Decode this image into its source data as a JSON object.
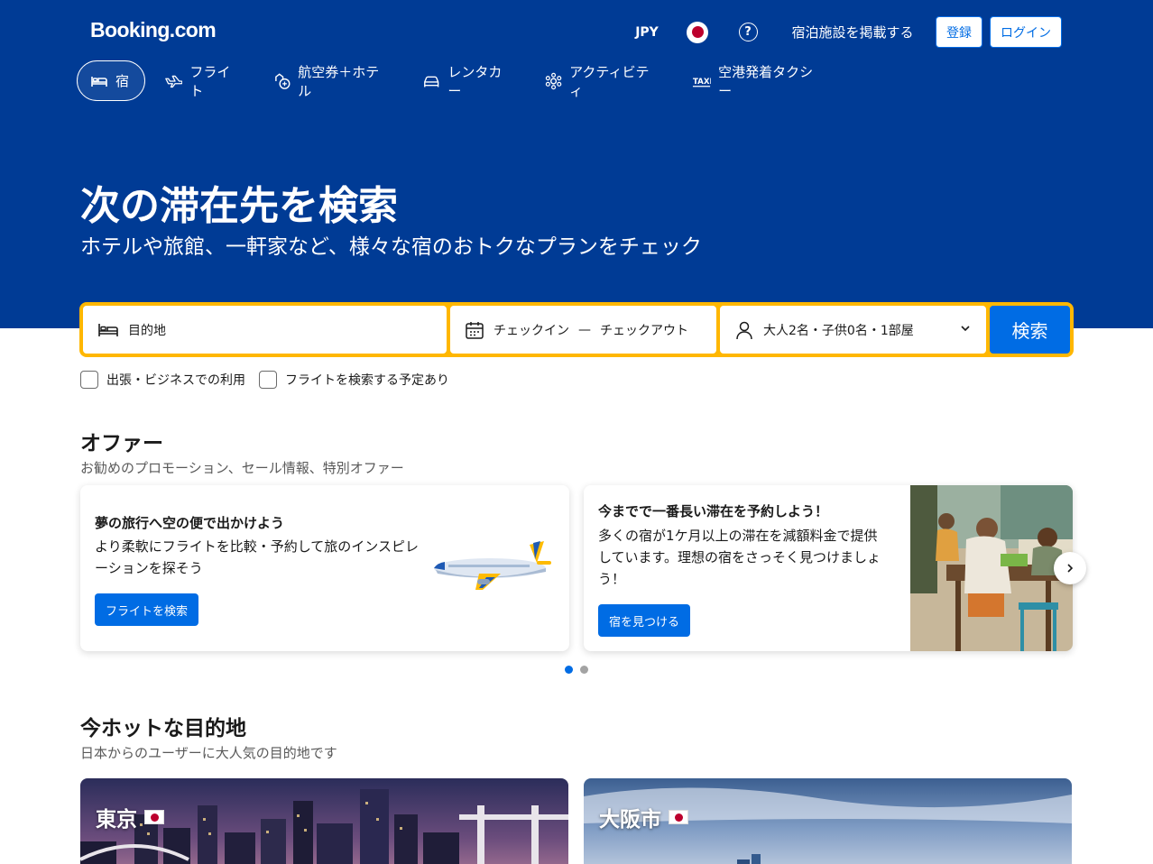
{
  "header": {
    "logo": "Booking.com",
    "currency": "JPY",
    "help_symbol": "?",
    "list_property": "宿泊施設を掲載する",
    "register": "登録",
    "login": "ログイン",
    "bg_color": "#003b95"
  },
  "nav": {
    "tabs": [
      {
        "label": "宿",
        "icon": "bed-icon",
        "active": true
      },
      {
        "label": "フライト",
        "icon": "plane-icon"
      },
      {
        "label": "航空券＋ホテル",
        "icon": "plane-hotel-icon"
      },
      {
        "label": "レンタカー",
        "icon": "car-icon"
      },
      {
        "label": "アクティビティ",
        "icon": "attractions-icon"
      },
      {
        "label": "空港発着タクシー",
        "icon": "taxi-icon"
      }
    ]
  },
  "hero": {
    "title": "次の滞在先を検索",
    "subtitle": "ホテルや旅館、一軒家など、様々な宿のおトクなプランをチェック"
  },
  "search": {
    "destination_placeholder": "目的地",
    "checkin": "チェックイン",
    "dash": "—",
    "checkout": "チェックアウト",
    "guests": "大人2名・子供0名・1部屋",
    "button": "検索",
    "accent_color": "#ffb700"
  },
  "options": {
    "business": "出張・ビジネスでの利用",
    "flights": "フライトを検索する予定あり"
  },
  "offers": {
    "title": "オファー",
    "subtitle": "お勧めのプロモーション、セール情報、特別オファー",
    "cards": [
      {
        "title": "夢の旅行へ空の便で出かけよう",
        "desc": "より柔軟にフライトを比較・予約して旅のインスピレーションを探そう",
        "button": "フライトを検索"
      },
      {
        "title": "今までで一番長い滞在を予約しよう！",
        "desc": "多くの宿が1ケ月以上の滞在を減額料金で提供しています。理想の宿をさっそく見つけましょう！",
        "button": "宿を見つける"
      }
    ]
  },
  "destinations": {
    "title": "今ホットな目的地",
    "subtitle": "日本からのユーザーに大人気の目的地です",
    "cards": [
      {
        "name": "東京"
      },
      {
        "name": "大阪市"
      }
    ]
  }
}
